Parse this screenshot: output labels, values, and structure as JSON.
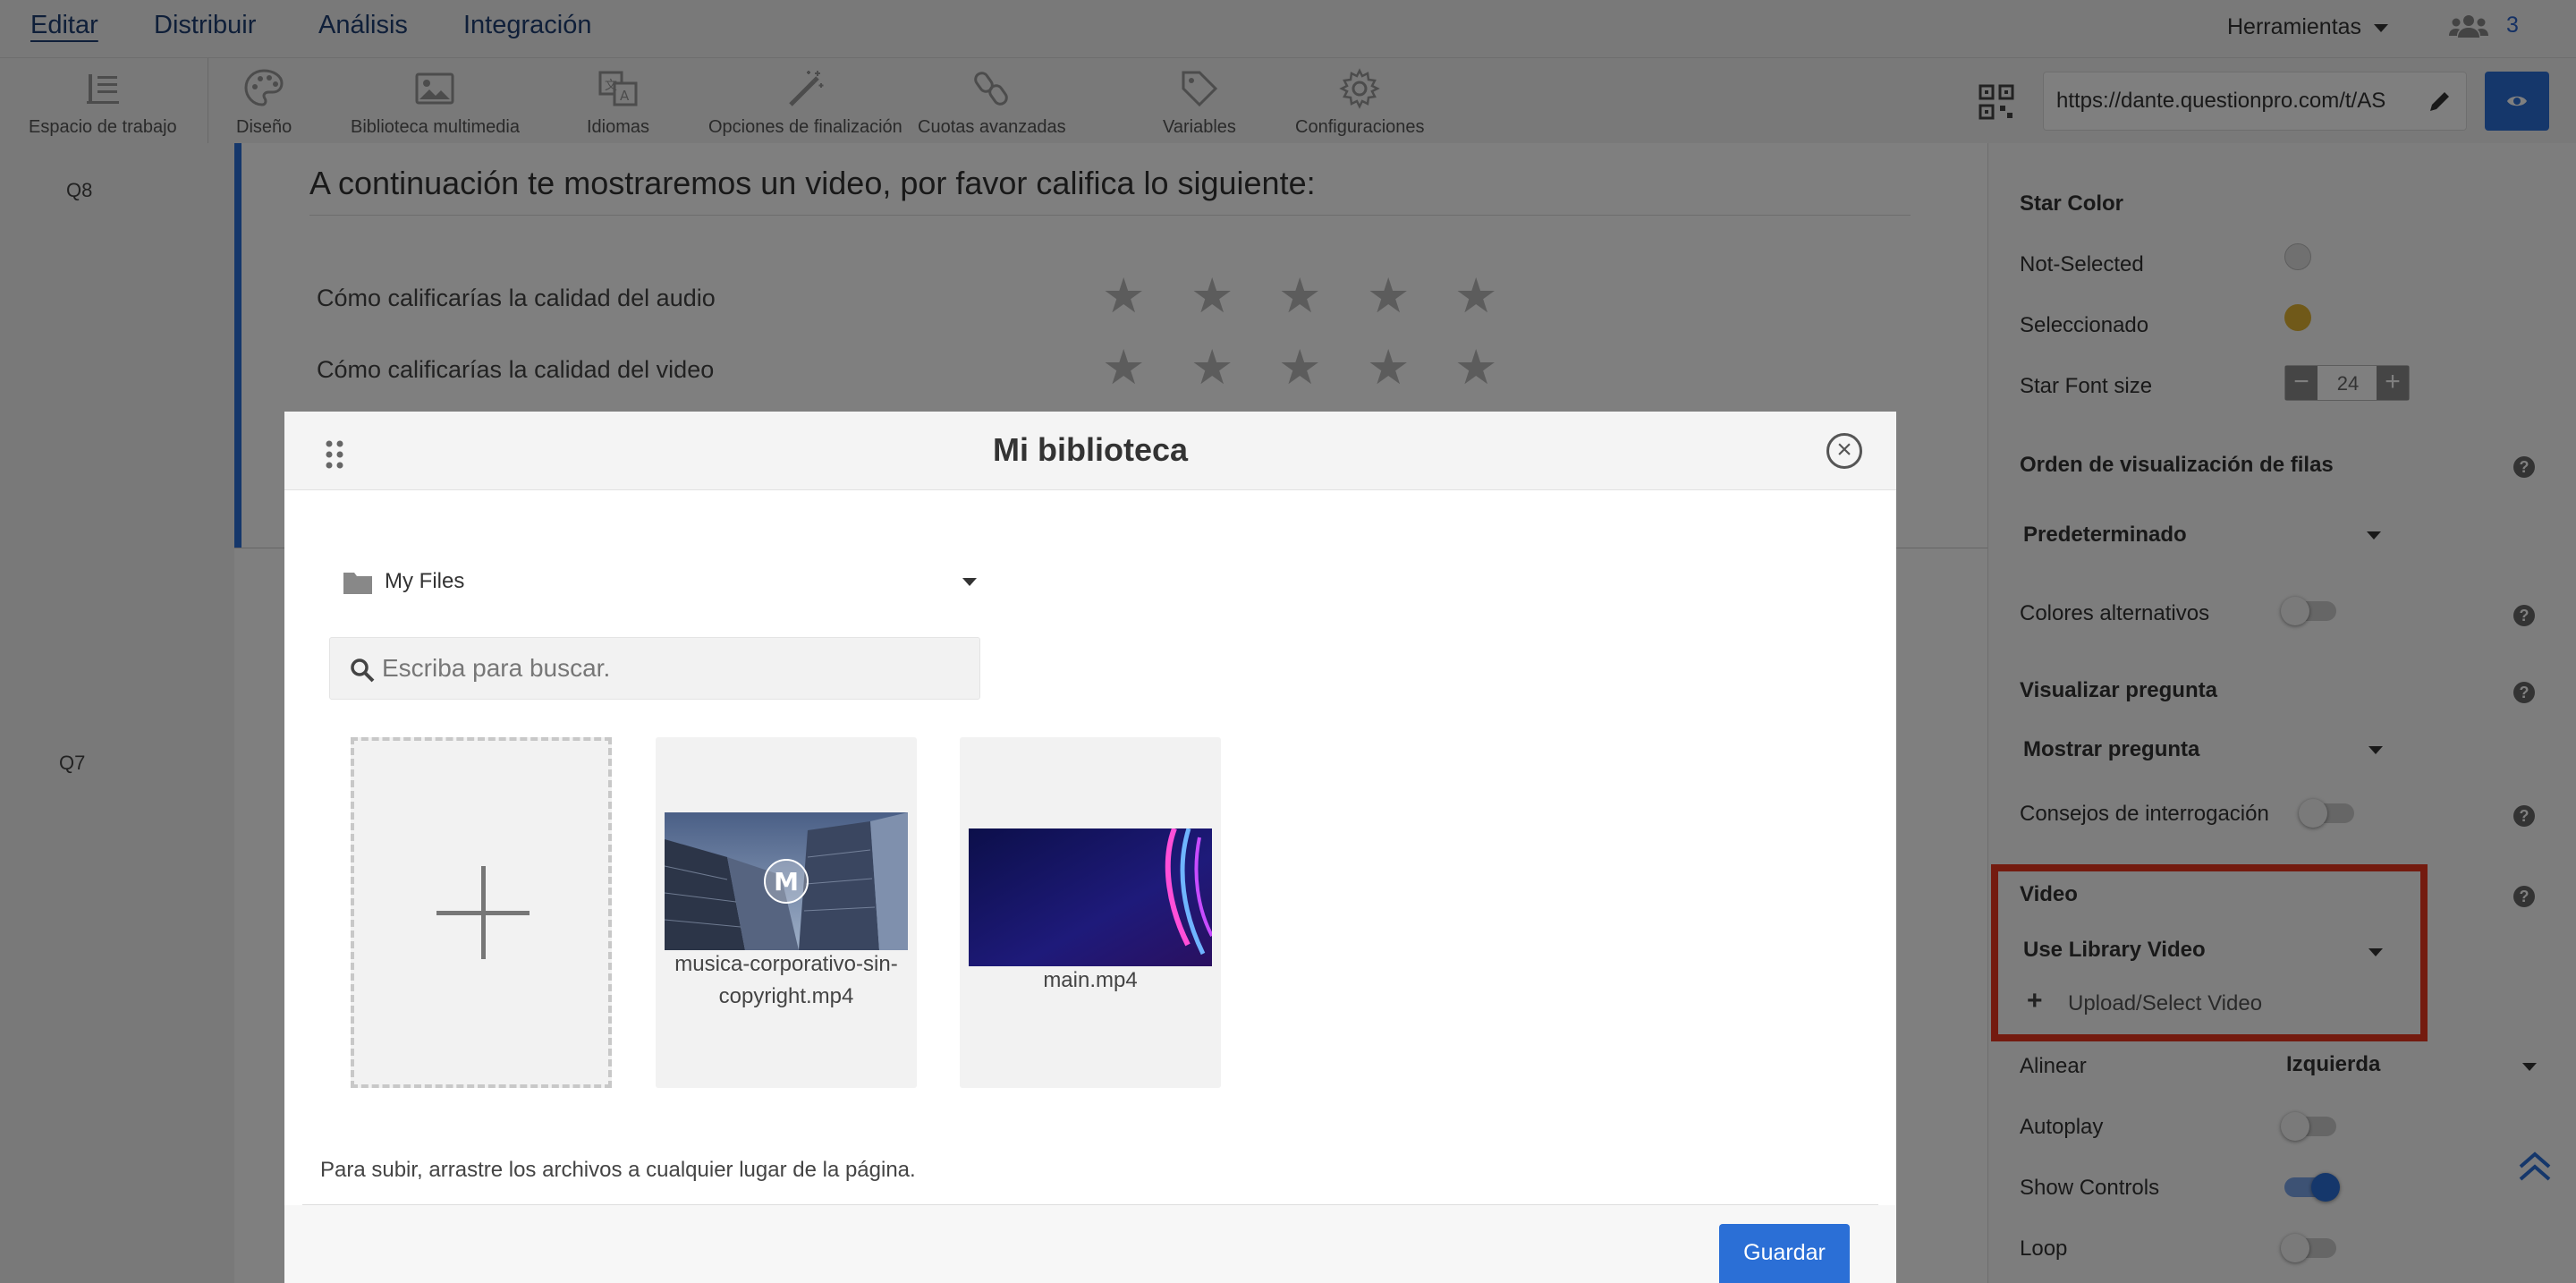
{
  "topnav": {
    "items": [
      "Editar",
      "Distribuir",
      "Análisis",
      "Integración"
    ],
    "tools_label": "Herramientas",
    "users_count": "3"
  },
  "toolbar": {
    "items": [
      "Espacio de trabajo",
      "Diseño",
      "Biblioteca multimedia",
      "Idiomas",
      "Opciones de finalización",
      "Cuotas avanzadas",
      "Variables",
      "Configuraciones"
    ],
    "url": "https://dante.questionpro.com/t/AS"
  },
  "survey": {
    "q8_label": "Q8",
    "q7_label": "Q7",
    "q8_title": "A continuación te mostraremos un video, por favor califica lo siguiente:",
    "rows": [
      "Cómo calificarías la calidad del audio",
      "Cómo calificarías la calidad del video"
    ],
    "star_char": "★"
  },
  "panel": {
    "star_color_title": "Star Color",
    "not_selected_label": "Not-Selected",
    "selected_label": "Seleccionado",
    "not_selected_color": "#e0e0e0",
    "selected_color": "#e0b332",
    "star_font_size_label": "Star Font size",
    "star_font_size_value": "24",
    "row_order_title": "Orden de visualización de filas",
    "row_order_value": "Predeterminado",
    "alt_colors_label": "Colores alternativos",
    "alt_colors_on": false,
    "show_question_title": "Visualizar pregunta",
    "show_question_value": "Mostrar pregunta",
    "hints_label": "Consejos de interrogación",
    "hints_on": false,
    "video_title": "Video",
    "video_source_value": "Use Library Video",
    "upload_label": "Upload/Select Video",
    "align_label": "Alinear",
    "align_value": "Izquierda",
    "autoplay_label": "Autoplay",
    "autoplay_on": false,
    "show_controls_label": "Show Controls",
    "show_controls_on": true,
    "loop_label": "Loop",
    "loop_on": false,
    "help_glyph": "?",
    "highlight_color": "#e8371e"
  },
  "modal": {
    "title": "Mi biblioteca",
    "close_glyph": "×",
    "folder": "My Files",
    "search_placeholder": "Escriba para buscar.",
    "files": [
      "musica-corporativo-sin-copyright.mp4",
      "main.mp4"
    ],
    "thumb_logo_letter": "M",
    "upload_hint": "Para subir, arrastre los archivos a cualquier lugar de la página.",
    "save_label": "Guardar"
  },
  "colors": {
    "accent": "#2b6fd6",
    "nav_text": "#1f3e73"
  }
}
